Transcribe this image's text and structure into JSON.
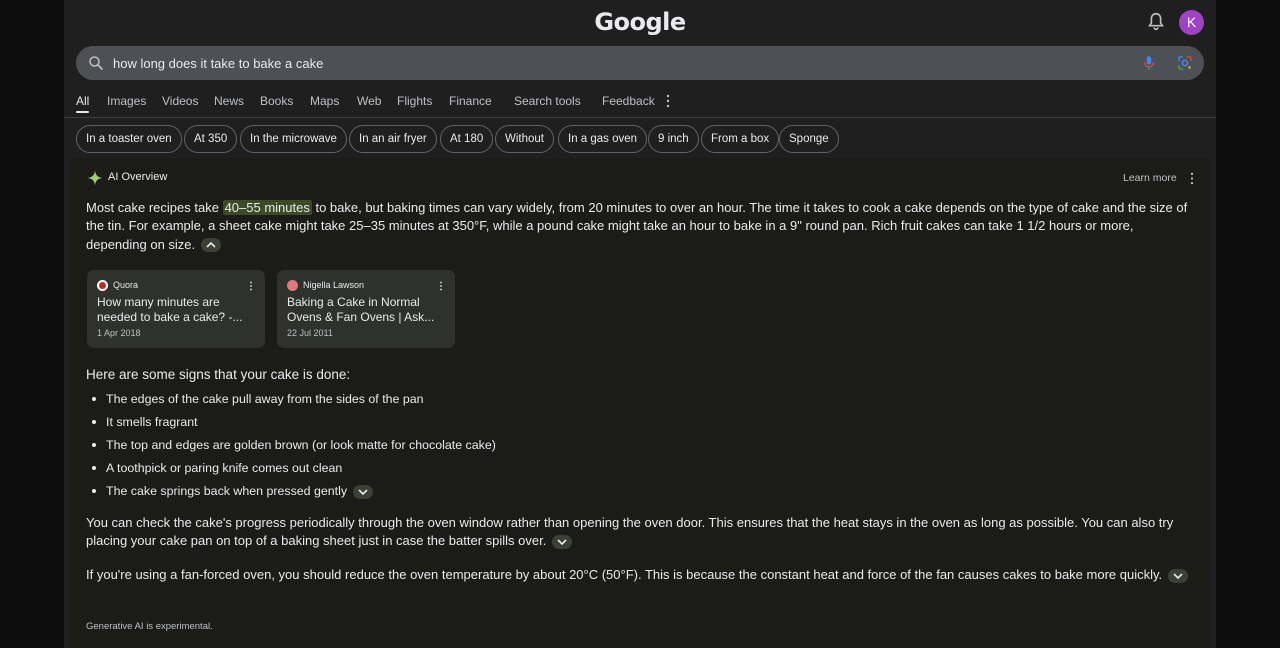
{
  "header": {
    "logo": "Google",
    "avatar_initial": "K"
  },
  "search": {
    "query": "how long does it take to bake a cake"
  },
  "tabs": [
    {
      "label": "All",
      "active": true
    },
    {
      "label": "Images"
    },
    {
      "label": "Videos"
    },
    {
      "label": "News"
    },
    {
      "label": "Books"
    },
    {
      "label": "Maps"
    },
    {
      "label": "Web"
    },
    {
      "label": "Flights"
    },
    {
      "label": "Finance"
    },
    {
      "label": "Search tools"
    },
    {
      "label": "Feedback"
    }
  ],
  "chips": [
    "In a toaster oven",
    "At 350",
    "In the microwave",
    "In an air fryer",
    "At 180",
    "Without",
    "In a gas oven",
    "9 inch",
    "From a box",
    "Sponge"
  ],
  "ai_overview": {
    "title": "AI Overview",
    "learn_more": "Learn more",
    "intro_pre": "Most cake recipes take ",
    "intro_highlight": "40–55 minutes",
    "intro_post": " to bake, but baking times can vary widely, from 20 minutes to over an hour. The time it takes to cook a cake depends on the type of cake and the size of the tin. For example, a sheet cake might take 25–35 minutes at 350°F, while a pound cake might take an hour to bake in a 9\" round pan. Rich fruit cakes can take 1 1/2 hours or more, depending on size.",
    "sources": [
      {
        "site": "Quora",
        "title": "How many minutes are needed to bake a cake? -...",
        "date": "1 Apr 2018",
        "favicon_color": "#b92b27"
      },
      {
        "site": "Nigella Lawson",
        "title": "Baking a Cake in Normal Ovens & Fan Ovens | Ask...",
        "date": "22 Jul 2011",
        "favicon_color": "#e07a7a"
      }
    ],
    "signs_heading": "Here are some signs that your cake is done:",
    "signs": [
      "The edges of the cake pull away from the sides of the pan",
      "It smells fragrant",
      "The top and edges are golden brown (or look matte for chocolate cake)",
      "A toothpick or paring knife comes out clean",
      "The cake springs back when pressed gently"
    ],
    "para2": "You can check the cake's progress periodically through the oven window rather than opening the oven door. This ensures that the heat stays in the oven as long as possible. You can also try placing your cake pan on top of a baking sheet just in case the batter spills over.",
    "para3": "If you're using a fan-forced oven, you should reduce the oven temperature by about 20°C (50°F). This is because the constant heat and force of the fan causes cakes to bake more quickly.",
    "footer": "Generative AI is experimental."
  },
  "colors": {
    "background": "#1f1f1f",
    "search_bar": "#4d5156",
    "highlight": "#3c4a25",
    "avatar": "#a142c4"
  }
}
